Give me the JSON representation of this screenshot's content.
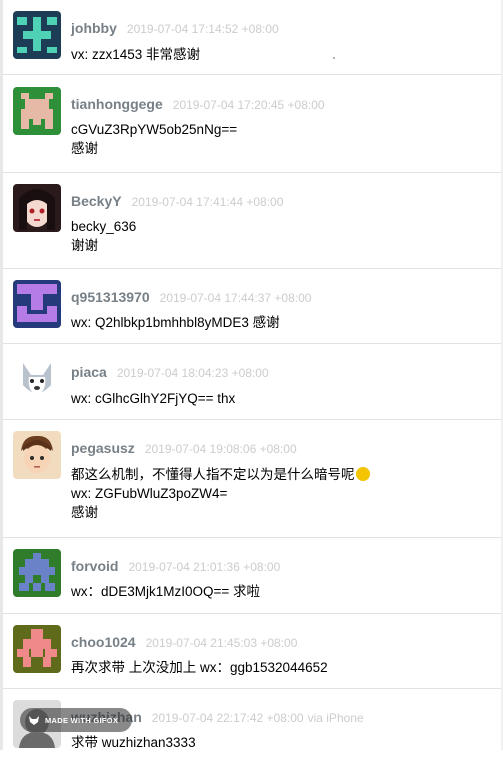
{
  "replies": [
    {
      "username": "johbby",
      "time": "2019-07-04 17:14:52 +08:00",
      "lines": [
        "vx: zzx1453 非常感谢"
      ]
    },
    {
      "username": "tianhonggege",
      "time": "2019-07-04 17:20:45 +08:00",
      "lines": [
        "cGVuZ3RpYW5ob25nNg==",
        "感谢"
      ]
    },
    {
      "username": "BeckyY",
      "time": "2019-07-04 17:41:44 +08:00",
      "lines": [
        "becky_636",
        "谢谢"
      ]
    },
    {
      "username": "q951313970",
      "time": "2019-07-04 17:44:37 +08:00",
      "lines": [
        "wx: Q2hlbkp1bmhhbl8yMDE3 感谢"
      ]
    },
    {
      "username": "piaca",
      "time": "2019-07-04 18:04:23 +08:00",
      "lines": [
        "wx: cGlhcGlhY2FjYQ== thx"
      ]
    },
    {
      "username": "pegasusz",
      "time": "2019-07-04 19:08:06 +08:00",
      "lines": [
        "都这么机制，不懂得人指不定以为是什么暗号呢",
        "wx: ZGFubWluZ3poZW4=",
        "感谢"
      ]
    },
    {
      "username": "forvoid",
      "time": "2019-07-04 21:01:36 +08:00",
      "lines": [
        "wx：dDE3Mjk1MzI0OQ== 求啦"
      ]
    },
    {
      "username": "choo1024",
      "time": "2019-07-04 21:45:03 +08:00",
      "lines": [
        "再次求带 上次没加上 wx：ggb1532044652"
      ]
    },
    {
      "username": "wuzhizhan",
      "time": "2019-07-04 22:17:42 +08:00",
      "via": "via iPhone",
      "lines": [
        "求带 wuzhizhan3333"
      ]
    }
  ],
  "watermark": {
    "label": "MADE WITH GIFOX"
  },
  "colors": {
    "username": "#778087",
    "time": "#cccccc",
    "divider": "#e2e2e2"
  }
}
